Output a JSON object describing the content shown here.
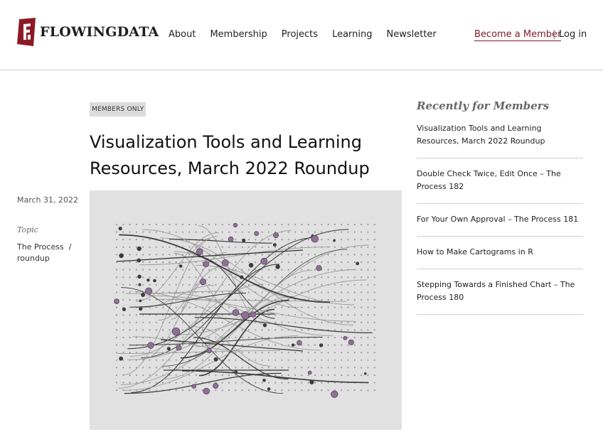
{
  "brand": {
    "name": "FLOWINGDATA",
    "logo_letter": "F",
    "accent": "#7e1b25"
  },
  "nav": {
    "items": [
      {
        "label": "About",
        "name": "nav-about"
      },
      {
        "label": "Membership",
        "name": "nav-membership"
      },
      {
        "label": "Projects",
        "name": "nav-projects"
      },
      {
        "label": "Learning",
        "name": "nav-learning"
      },
      {
        "label": "Newsletter",
        "name": "nav-newsletter"
      }
    ],
    "become_member": "Become a Member",
    "separator": "|",
    "login": "Log in"
  },
  "article": {
    "badge": "MEMBERS ONLY",
    "title": "Visualization Tools and Learning Resources, March 2022 Roundup",
    "date": "March 31, 2022",
    "topic_label": "Topic",
    "topics": [
      "The Process",
      "roundup"
    ],
    "topic_separator": "/"
  },
  "sidebar": {
    "title": "Recently for Members",
    "items": [
      {
        "label": "Visualization Tools and Learning Resources, March 2022 Roundup"
      },
      {
        "label": "Double Check Twice, Edit Once – The Process 182"
      },
      {
        "label": "For Your Own Approval – The Process 181"
      },
      {
        "label": "How to Make Cartograms in R"
      },
      {
        "label": "Stepping Towards a Finished Chart – The Process 180"
      }
    ]
  }
}
